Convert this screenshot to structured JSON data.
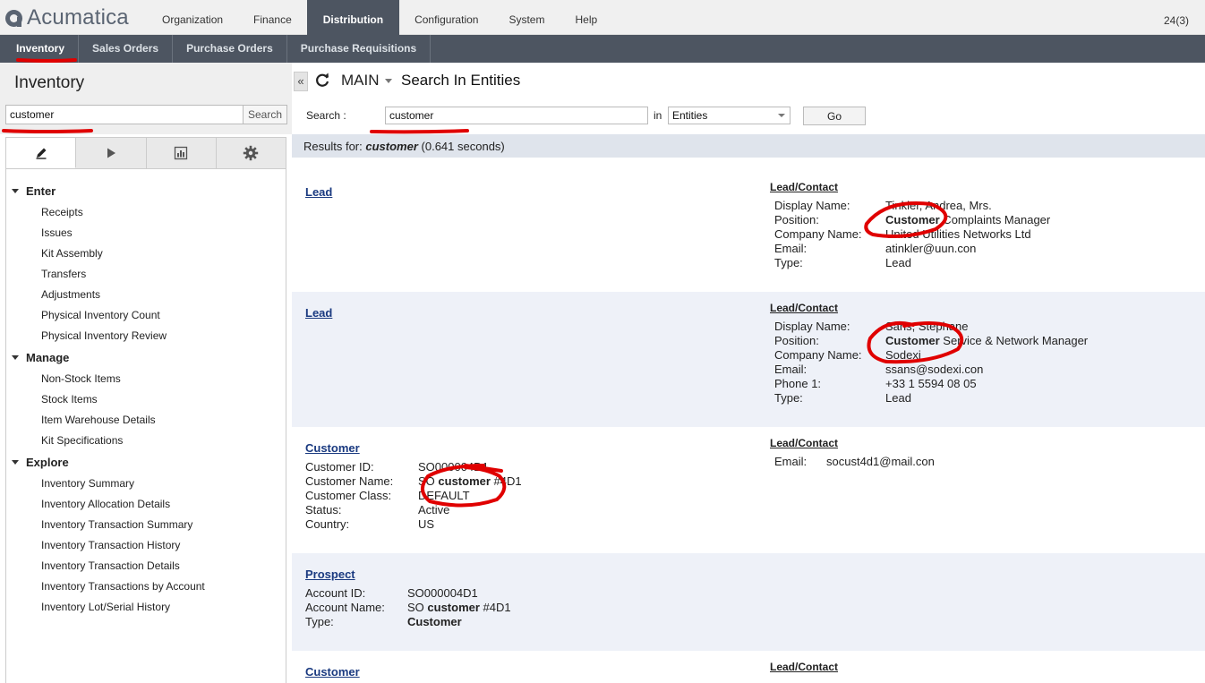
{
  "app": {
    "logo_text": "Acumatica",
    "count": "24(3)"
  },
  "top_menu": [
    "Organization",
    "Finance",
    "Distribution",
    "Configuration",
    "System",
    "Help"
  ],
  "sub_menu": [
    "Inventory",
    "Sales Orders",
    "Purchase Orders",
    "Purchase Requisitions"
  ],
  "left": {
    "title": "Inventory",
    "search_value": "customer",
    "search_button": "Search",
    "groups": [
      {
        "label": "Enter",
        "items": [
          "Receipts",
          "Issues",
          "Kit Assembly",
          "Transfers",
          "Adjustments",
          "Physical Inventory Count",
          "Physical Inventory Review"
        ]
      },
      {
        "label": "Manage",
        "items": [
          "Non-Stock Items",
          "Stock Items",
          "Item Warehouse Details",
          "Kit Specifications"
        ]
      },
      {
        "label": "Explore",
        "items": [
          "Inventory Summary",
          "Inventory Allocation Details",
          "Inventory Transaction Summary",
          "Inventory Transaction History",
          "Inventory Transaction Details",
          "Inventory Transactions by Account",
          "Inventory Lot/Serial History"
        ]
      }
    ]
  },
  "main": {
    "workspace": "MAIN",
    "title": "Search In Entities",
    "search_label": "Search :",
    "search_value": "customer",
    "in_label": "in",
    "entity": "Entities",
    "go": "Go",
    "results_prefix": "Results for:",
    "results_term": "customer",
    "results_time": "(0.641 seconds)"
  },
  "results": [
    {
      "link": "Lead",
      "right_title": "Lead/Contact",
      "right_rows": [
        [
          "Display Name:",
          "Tinkler, Andrea, Mrs."
        ],
        [
          "Position:",
          "Customer Complaints Manager"
        ],
        [
          "Company Name:",
          "United Utilities Networks Ltd"
        ],
        [
          "Email:",
          "atinkler@uun.con"
        ],
        [
          "Type:",
          "Lead"
        ]
      ]
    },
    {
      "link": "Lead",
      "right_title": "Lead/Contact",
      "right_rows": [
        [
          "Display Name:",
          "Sans, Stephane"
        ],
        [
          "Position:",
          "Customer Service & Network Manager"
        ],
        [
          "Company Name:",
          "Sodexi"
        ],
        [
          "Email:",
          "ssans@sodexi.con"
        ],
        [
          "Phone 1:",
          "+33 1 5594 08 05"
        ],
        [
          "Type:",
          "Lead"
        ]
      ]
    },
    {
      "link": "Customer",
      "left_rows": [
        [
          "Customer ID:",
          "SO000004D1"
        ],
        [
          "Customer Name:",
          "SO customer #4D1"
        ],
        [
          "Customer Class:",
          "DEFAULT"
        ],
        [
          "Status:",
          "Active"
        ],
        [
          "Country:",
          "US"
        ]
      ],
      "right_title": "Lead/Contact",
      "right_rows": [
        [
          "Email:",
          "socust4d1@mail.con"
        ]
      ]
    },
    {
      "link": "Prospect",
      "left_rows": [
        [
          "Account ID:",
          "SO000004D1"
        ],
        [
          "Account Name:",
          "SO customer #4D1"
        ],
        [
          "Type:",
          "Customer"
        ]
      ]
    },
    {
      "link": "Customer",
      "right_title": "Lead/Contact"
    }
  ]
}
